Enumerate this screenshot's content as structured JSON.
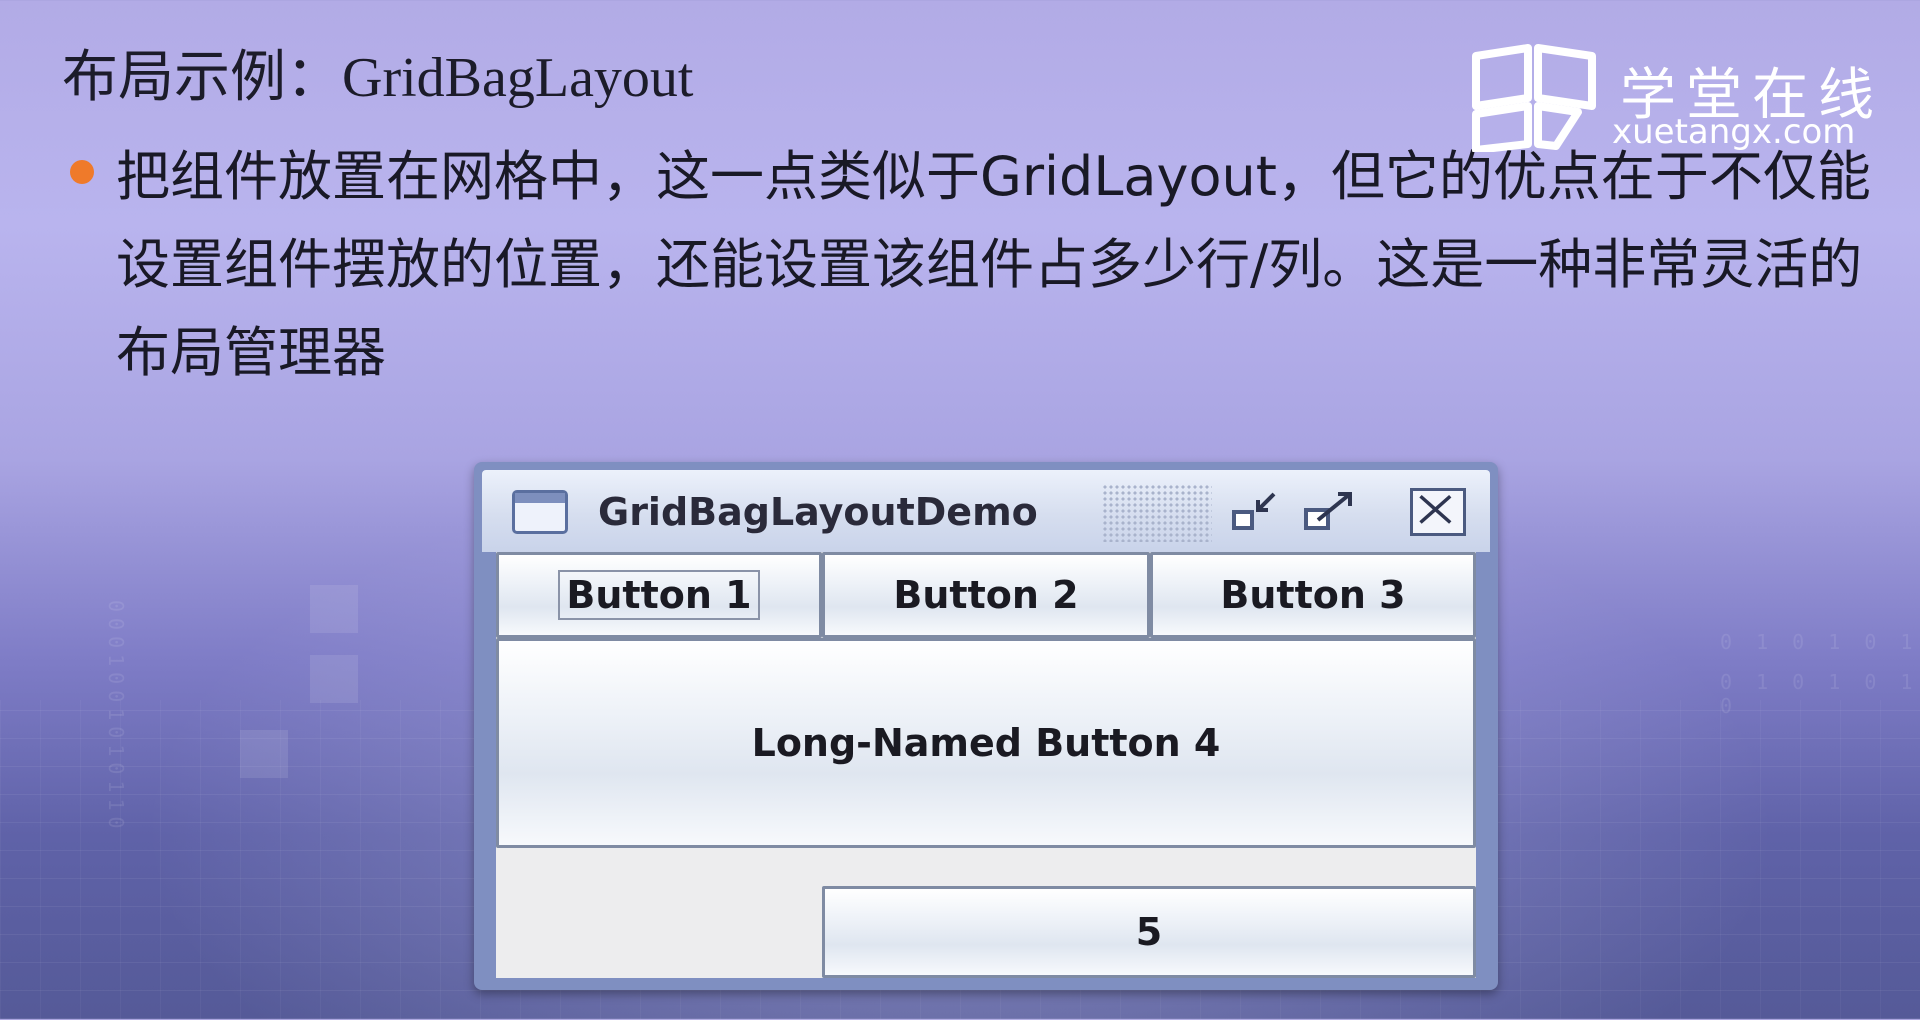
{
  "slide": {
    "title": "布局示例：GridBagLayout",
    "bullet": "把组件放置在网格中，这一点类似于GridLayout，但它的优点在于不仅能设置组件摆放的位置，还能设置该组件占多少行/列。这是一种非常灵活的布局管理器"
  },
  "logo": {
    "name": "学堂在线",
    "domain": "xuetangx.com"
  },
  "window": {
    "title": "GridBagLayoutDemo",
    "icons": [
      "window-icon",
      "minimize-icon",
      "maximize-icon",
      "close-icon"
    ],
    "buttons": {
      "b1": "Button 1",
      "b2": "Button 2",
      "b3": "Button 3",
      "b4": "Long-Named Button 4",
      "b5": "5"
    }
  },
  "colors": {
    "bullet": "#ef7a2a",
    "window_frame": "#7f8fc1",
    "background_top": "#b2abe6",
    "background_bottom": "#555a98"
  }
}
